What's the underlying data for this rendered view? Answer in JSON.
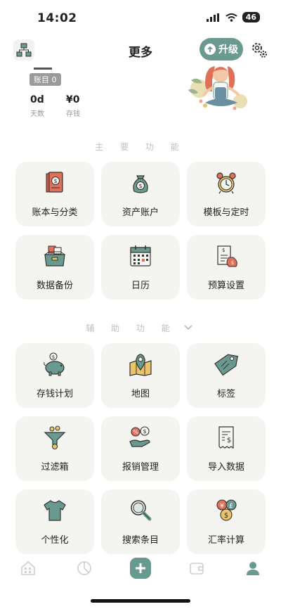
{
  "status": {
    "time": "14:02",
    "battery": "46"
  },
  "header": {
    "title": "更多",
    "upgrade_label": "升级"
  },
  "profile": {
    "badge": "账目 0",
    "days_value": "0d",
    "days_label": "天数",
    "saving_value": "¥0",
    "saving_label": "存钱"
  },
  "sections": {
    "main": {
      "title": "主 要 功 能",
      "items": [
        "账本与分类",
        "资产账户",
        "模板与定时",
        "数据备份",
        "日历",
        "预算设置"
      ]
    },
    "aux": {
      "title": "辅 助 功 能",
      "items": [
        "存钱计划",
        "地图",
        "标签",
        "过滤箱",
        "报销管理",
        "导入数据",
        "个性化",
        "搜索条目",
        "汇率计算"
      ]
    }
  },
  "tabs": [
    "home",
    "stats",
    "add",
    "wallet",
    "profile"
  ],
  "colors": {
    "accent": "#6a9a8f",
    "card": "#f4f4f1"
  }
}
